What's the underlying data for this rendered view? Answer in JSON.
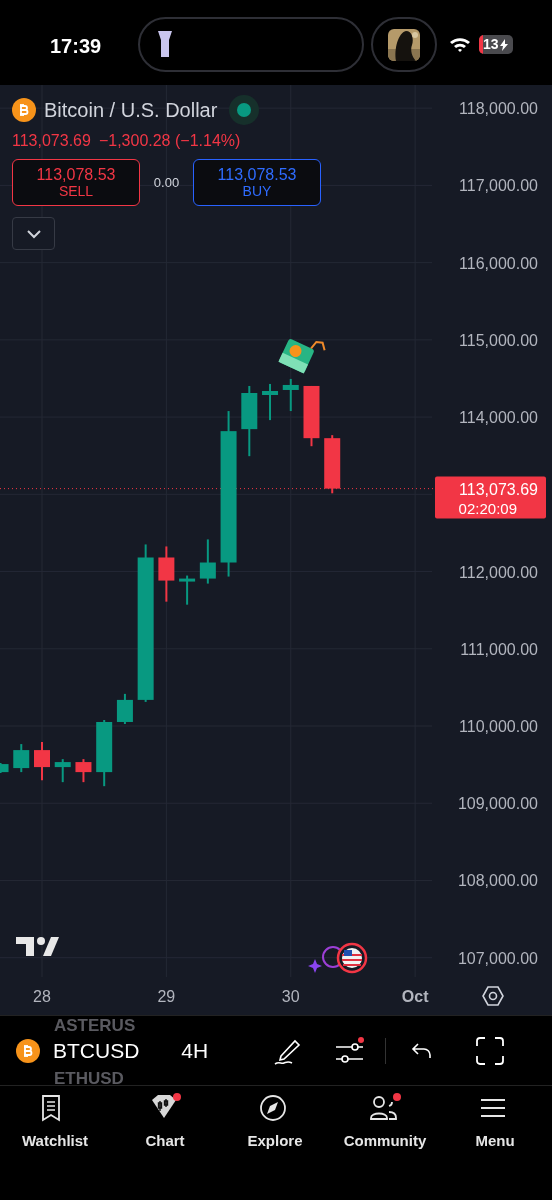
{
  "status_bar": {
    "time": "17:39",
    "battery": "13"
  },
  "symbol": {
    "name": "Bitcoin / U.S. Dollar",
    "market_open": true,
    "price": "113,073.69",
    "change": "−1,300.28 (−1.14%)",
    "sell": {
      "price": "113,078.53",
      "label": "SELL"
    },
    "spread": "0.00",
    "buy": {
      "price": "113,078.53",
      "label": "BUY"
    }
  },
  "chart": {
    "chart_data": {
      "type": "candlestick",
      "categories": [
        null,
        null,
        "28",
        null,
        null,
        null,
        null,
        null,
        "29",
        null,
        null,
        null,
        null,
        null,
        "30",
        null,
        null,
        null,
        null,
        null,
        "Oct"
      ],
      "ohlc": [
        [
          109403,
          109520,
          109390,
          109507
        ],
        [
          109455,
          109766,
          109403,
          109688
        ],
        [
          109688,
          109792,
          109299,
          109468
        ],
        [
          109468,
          109571,
          109273,
          109533
        ],
        [
          109533,
          109571,
          109273,
          109403
        ],
        [
          109403,
          110078,
          109221,
          110052
        ],
        [
          110052,
          110416,
          110026,
          110338
        ],
        [
          110338,
          112351,
          110312,
          112182
        ],
        [
          112182,
          112325,
          111610,
          111883
        ],
        [
          111883,
          111948,
          111571,
          111909
        ],
        [
          111909,
          112416,
          111844,
          112117
        ],
        [
          112117,
          114078,
          111935,
          113818
        ],
        [
          113844,
          114403,
          113494,
          114312
        ],
        [
          114286,
          114429,
          113961,
          114338
        ],
        [
          114351,
          114494,
          114078,
          114416
        ],
        [
          114403,
          114403,
          113623,
          113727
        ],
        [
          113727,
          113766,
          113013,
          113074
        ],
        null,
        null,
        null,
        null
      ],
      "ylim": [
        106750,
        118300
      ],
      "yticks": [
        {
          "value": 118000,
          "label": "118,000.00"
        },
        {
          "value": 117000,
          "label": "117,000.00"
        },
        {
          "value": 116000,
          "label": "116,000.00"
        },
        {
          "value": 115000,
          "label": "115,000.00"
        },
        {
          "value": 114000,
          "label": "114,000.00"
        },
        {
          "value": 112000,
          "label": "112,000.00"
        },
        {
          "value": 111000,
          "label": "111,000.00"
        },
        {
          "value": 110000,
          "label": "110,000.00"
        },
        {
          "value": 109000,
          "label": "109,000.00"
        },
        {
          "value": 108000,
          "label": "108,000.00"
        },
        {
          "value": 107000,
          "label": "107,000.00"
        }
      ],
      "grid": true,
      "ref_lines": [
        {
          "axis": "y",
          "value": 113073.69,
          "color": "#f23645"
        }
      ]
    },
    "last_price": {
      "price": "113,073.69",
      "countdown": "02:20:09"
    }
  },
  "toolbar": {
    "symbol": "BTCUSD",
    "interval": "4H",
    "ghost_symbols": [
      "ASTERUS",
      "ETHUSD"
    ]
  },
  "nav": [
    {
      "label": "Watchlist",
      "badge": false
    },
    {
      "label": "Chart",
      "badge": true
    },
    {
      "label": "Explore",
      "badge": false
    },
    {
      "label": "Community",
      "badge": true
    },
    {
      "label": "Menu",
      "badge": false
    }
  ]
}
